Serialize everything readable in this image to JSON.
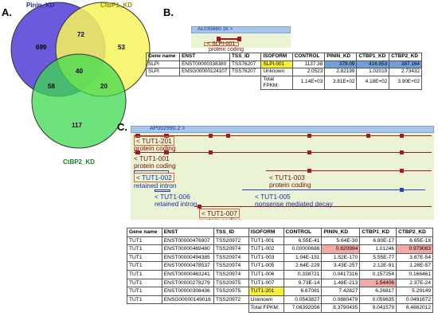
{
  "panelA": {
    "label": "A.",
    "sets": [
      {
        "name": "Pinin_KD",
        "color": "#6a5bdc"
      },
      {
        "name": "CtBP1_KD",
        "color": "#f6f55c"
      },
      {
        "name": "CtBP2_KD",
        "color": "#3fd94f"
      }
    ],
    "counts": {
      "pinin_only": "699",
      "pinin_ctbp1": "72",
      "ctbp1_only": "53",
      "all_three": "40",
      "pinin_ctbp2": "58",
      "ctbp1_ctbp2": "20",
      "ctbp2_only": "117"
    }
  },
  "panelB": {
    "label": "B.",
    "clone": "AL035660.16 >",
    "isoform_label": "< SLPI-001",
    "isoform_sub": "protein coding",
    "headers": [
      "Gene name",
      "ENST",
      "TSS_ID",
      "ISOFORM",
      "CONTROL",
      "PININ_KD",
      "CTBP1_KD",
      "CTBP2_KD"
    ],
    "rows": [
      [
        "SLPI",
        "ENST00000338380",
        "TSS76207",
        "SLPI-001",
        "1137.38",
        "378.09",
        "416.853",
        "387.164"
      ],
      [
        "SLPI",
        "ENSG00000124107",
        "TSS76207",
        "Unknown",
        "2.0523",
        "2.82199",
        "1.02019",
        "2.73432"
      ]
    ],
    "total_label": "Total FPKM:",
    "totals": [
      "1.14E+03",
      "3.81E+02",
      "4.18E+02",
      "3.90E+02"
    ]
  },
  "panelC": {
    "label": "C.",
    "clone": "AP002990.2 >",
    "transcripts": [
      {
        "name": "< TUT1-201",
        "type": "protein coding"
      },
      {
        "name": "< TUT1-001",
        "type": "protein coding"
      },
      {
        "name": "< TUT1-002",
        "type": "retained intron"
      },
      {
        "name": "< TUT1-003",
        "type": "protein coding"
      },
      {
        "name": "< TUT1-006",
        "type": "retained intron"
      },
      {
        "name": "< TUT1-005",
        "type": "nonsense mediated decay"
      },
      {
        "name": "< TUT1-007",
        "type": "protein coding"
      }
    ],
    "headers": [
      "Gene name",
      "ENST",
      "TSS_ID",
      "ISOFORM",
      "CONTROL",
      "PININ_KD",
      "CTBP1_KD",
      "CTBP2_KD"
    ],
    "rows": [
      [
        "TUT1",
        "ENST00000476907",
        "TSS20972",
        "TUT1-001",
        "6.55E-41",
        "5.64E-30",
        "6.80E-17",
        "6.65E-18"
      ],
      [
        "TUT1",
        "ENST00000469480",
        "TSS20974",
        "TUT1-002",
        "0.00000686",
        "0.820994",
        "1.01246",
        "0.979083"
      ],
      [
        "TUT1",
        "ENST00000494385",
        "TSS20974",
        "TUT1-003",
        "1.04E-131",
        "1.52E-170",
        "5.55E-77",
        "3.87E-54"
      ],
      [
        "TUT1",
        "ENST00000478537",
        "TSS20974",
        "TUT1-005",
        "2.64E-229",
        "3.43E-257",
        "2.12E-91",
        "1.28E-57"
      ],
      [
        "TUT1",
        "ENST00000463241",
        "TSS20974",
        "TUT1-006",
        "0.338721",
        "0.0417316",
        "0.157254",
        "0.166461"
      ],
      [
        "TUT1",
        "ENST00000278279",
        "TSS20975",
        "TUT1-007",
        "9.73E-14",
        "1.48E-213",
        "1.54406",
        "2.37E-24"
      ],
      [
        "TUT1",
        "ENST00000308436",
        "TSS20975",
        "TUT1-201",
        "6.67081",
        "7.42827",
        "6.26817",
        "5.29149"
      ],
      [
        "TUT1",
        "ENSG00000149016",
        "TSS20972",
        "Unknown",
        "0.0543827",
        "0.0880479",
        "0.059635",
        "0.0491672"
      ]
    ],
    "total_label": "Total FPKM:",
    "totals": [
      "7.06392056",
      "8.3790435",
      "9.041579",
      "6.4862012"
    ]
  }
}
